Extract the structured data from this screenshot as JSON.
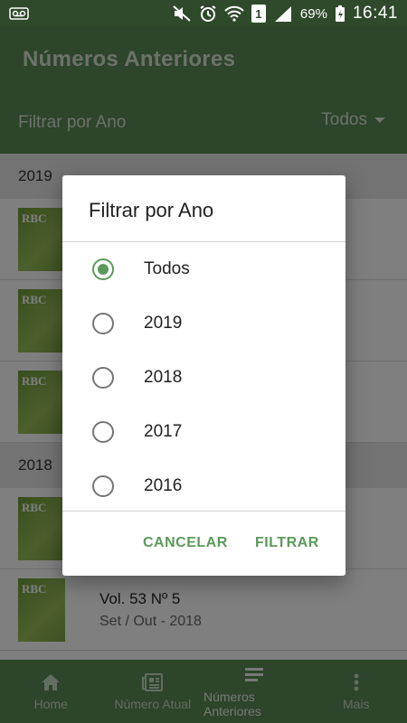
{
  "status_bar": {
    "battery": "69%",
    "time": "16:41",
    "sim_slot": "1"
  },
  "app_bar": {
    "title": "Números Anteriores",
    "filter_label": "Filtrar por Ano",
    "filter_value": "Todos"
  },
  "list": {
    "sections": [
      {
        "year": "2019"
      },
      {
        "year": "2018"
      }
    ],
    "cover_text": "RBC",
    "visible_issue": {
      "title": "Vol. 53 Nº 5",
      "subtitle": "Set / Out - 2018"
    }
  },
  "dialog": {
    "title": "Filtrar por Ano",
    "options": [
      {
        "label": "Todos",
        "selected": true
      },
      {
        "label": "2019",
        "selected": false
      },
      {
        "label": "2018",
        "selected": false
      },
      {
        "label": "2017",
        "selected": false
      },
      {
        "label": "2016",
        "selected": false
      }
    ],
    "cancel_label": "CANCELAR",
    "confirm_label": "FILTRAR"
  },
  "bottom_nav": {
    "items": [
      {
        "label": "Home",
        "icon": "home-icon",
        "active": false
      },
      {
        "label": "Número Atual",
        "icon": "newspaper-icon",
        "active": false
      },
      {
        "label": "Números Anteriores",
        "icon": "list-icon",
        "active": true
      },
      {
        "label": "Mais",
        "icon": "more-vert-icon",
        "active": false
      }
    ]
  },
  "colors": {
    "primary": "#5a8a55",
    "status_bar": "#2f4a2b",
    "accent": "#5a9a5a"
  }
}
